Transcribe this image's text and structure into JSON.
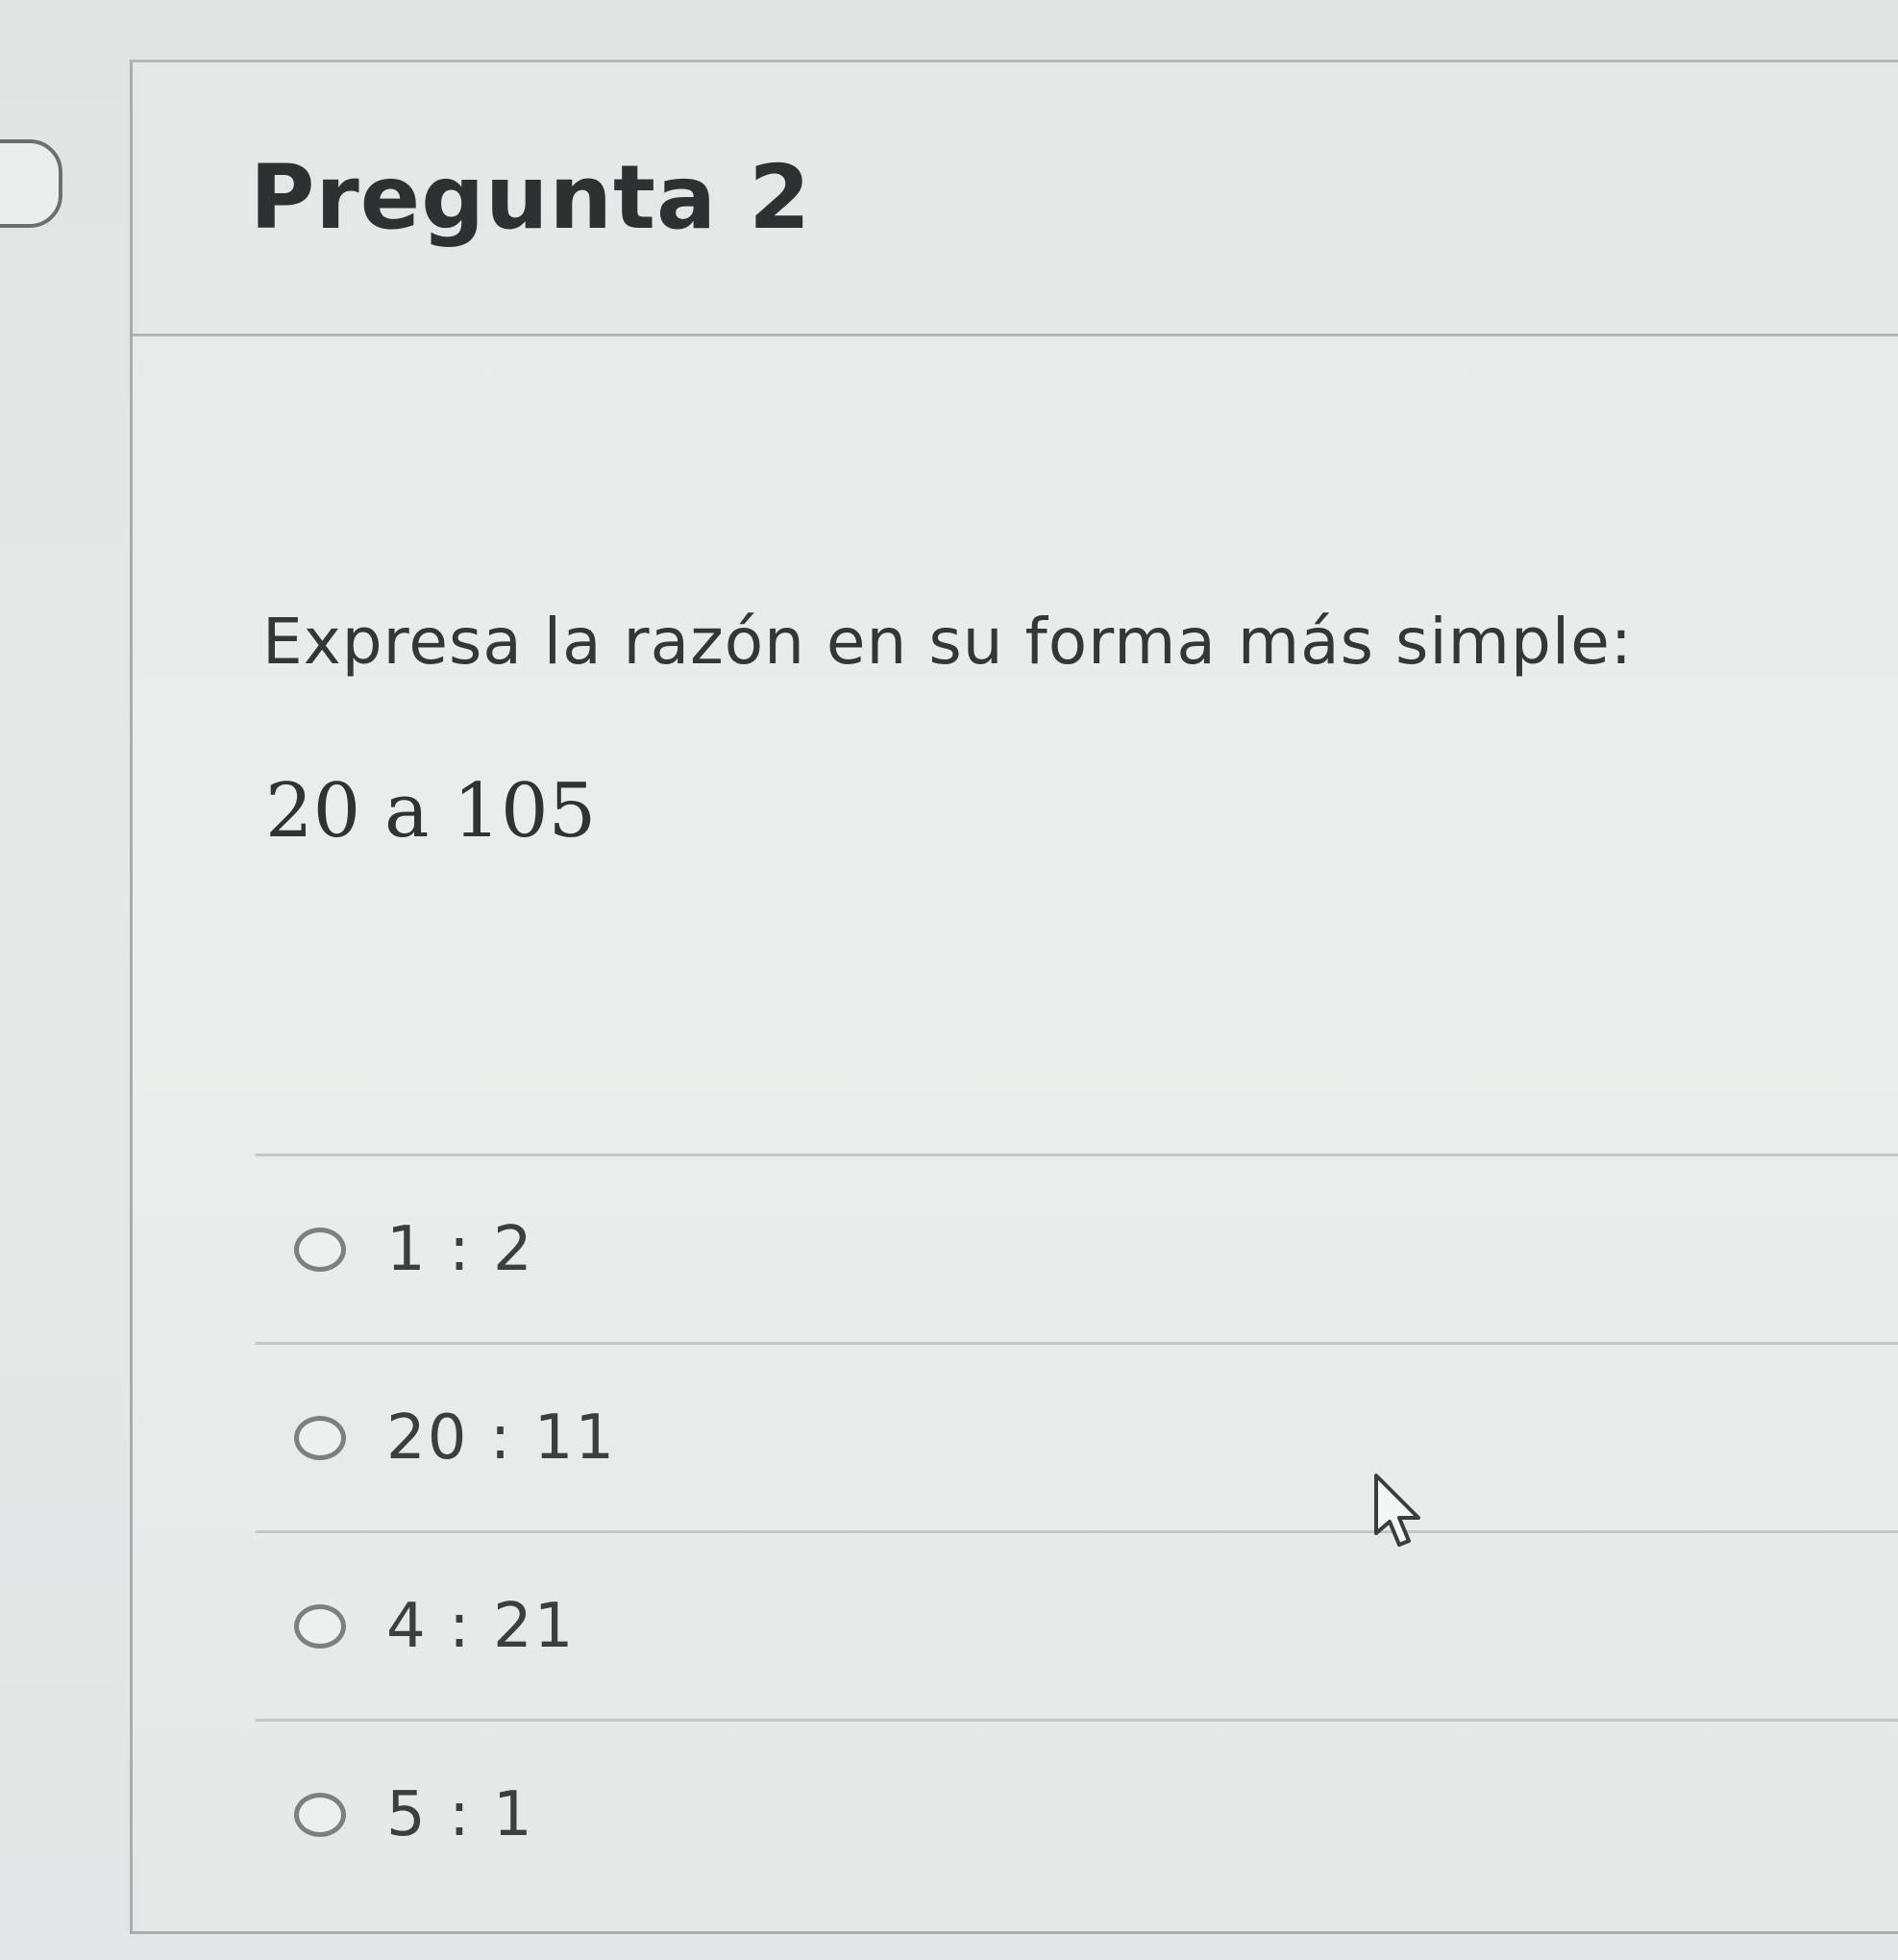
{
  "question": {
    "title": "Pregunta 2",
    "prompt": "Expresa la razón en su forma más simple:",
    "expression": "20 a 105"
  },
  "options": [
    {
      "label": "1 : 2",
      "selected": false
    },
    {
      "label": "20 : 11",
      "selected": false
    },
    {
      "label": "4 : 21",
      "selected": false
    },
    {
      "label": "5 : 1",
      "selected": false
    }
  ],
  "icons": {
    "radio": "radio-button-icon",
    "cursor": "mouse-pointer-icon",
    "flag": "question-flag-icon"
  }
}
